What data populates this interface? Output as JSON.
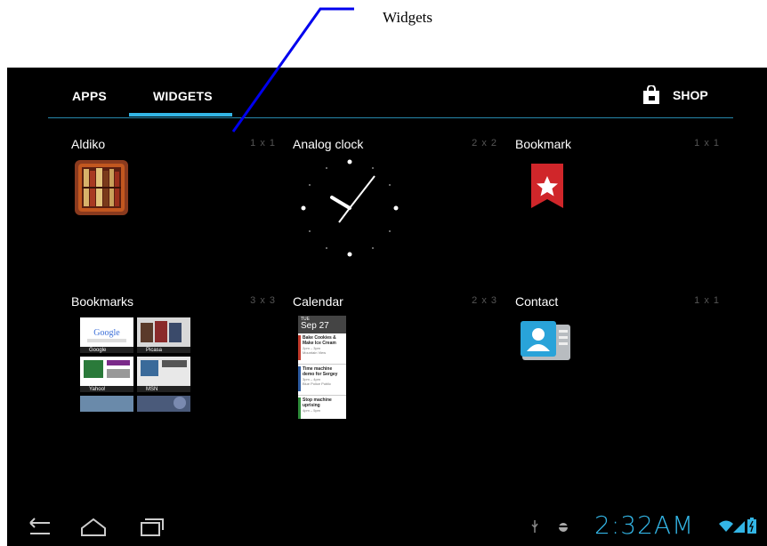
{
  "callout": {
    "label": "Widgets"
  },
  "tabs": [
    {
      "label": "APPS",
      "selected": false
    },
    {
      "label": "WIDGETS",
      "selected": true
    }
  ],
  "shop": {
    "label": "SHOP",
    "icon": "shopping-bag-icon"
  },
  "widgets": [
    {
      "name": "Aldiko",
      "size": "1 x 1",
      "preview": "bookshelf-icon"
    },
    {
      "name": "Analog clock",
      "size": "2 x 2",
      "preview": "analog-clock-preview"
    },
    {
      "name": "Bookmark",
      "size": "1 x 1",
      "preview": "bookmark-star-icon"
    },
    {
      "name": "Bookmarks",
      "size": "3 x 3",
      "preview": "bookmarks-grid-preview",
      "tiles": [
        {
          "label": "Google"
        },
        {
          "label": "Picasa"
        },
        {
          "label": "Yahoo!"
        },
        {
          "label": "MSN"
        }
      ]
    },
    {
      "name": "Calendar",
      "size": "2 x 3",
      "preview": "calendar-preview",
      "calendar": {
        "day": "TUE",
        "date": "Sep 27",
        "events": [
          {
            "title": "Bake Cookies & Make Ice Cream",
            "time": "2pm – 3pm",
            "place": "Mountain View",
            "color": "#c0392b"
          },
          {
            "title": "Time machine demo for Sergey",
            "time": "3pm – 4pm",
            "place": "Blue Police Public",
            "color": "#2c5aa0"
          },
          {
            "title": "Stop machine uprising",
            "time": "4pm – 5pm",
            "place": "",
            "color": "#2e8b3a"
          }
        ]
      }
    },
    {
      "name": "Contact",
      "size": "1 x 1",
      "preview": "contact-card-icon"
    }
  ],
  "navbar": {
    "buttons": [
      "back-icon",
      "home-icon",
      "recent-apps-icon"
    ],
    "status": {
      "time": "2:32AM",
      "icons": [
        "usb-icon",
        "usb-debug-icon",
        "wifi-icon",
        "signal-icon",
        "battery-icon"
      ]
    }
  },
  "colors": {
    "accent": "#33b5e5",
    "background": "#000000",
    "callout_line": "#0000ee"
  }
}
